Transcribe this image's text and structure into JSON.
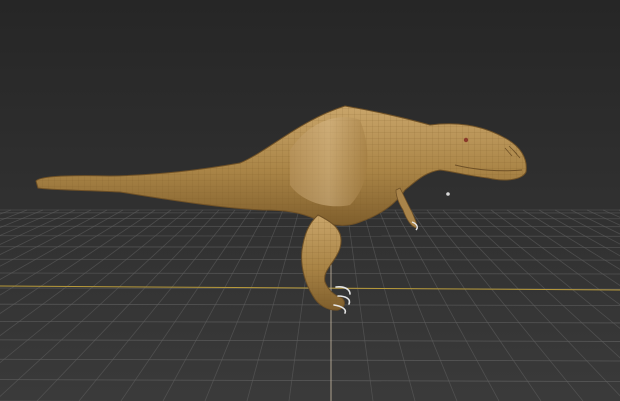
{
  "viewport": {
    "kind": "3d-perspective-viewport",
    "background_color": "#2b2b2b",
    "grid": {
      "visible": true,
      "line_color": "#5f5f5f",
      "axis_x_color": "#b89a3a",
      "axis_y_color": "#c7b8a0"
    },
    "model": {
      "subject": "dinosaur",
      "material_color": "#b8924f",
      "wireframe_overlay": true,
      "selected": false
    },
    "pivot_marker": {
      "visible": true,
      "color": "#d9d9d9"
    }
  }
}
